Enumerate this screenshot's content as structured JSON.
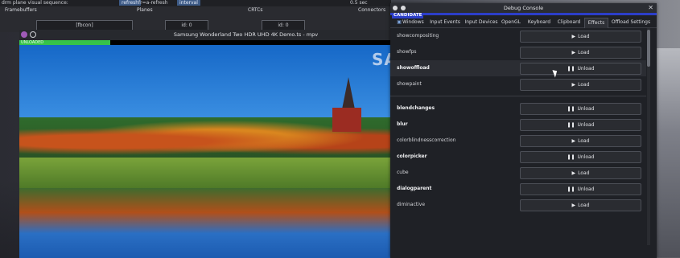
{
  "drm": {
    "topbar_left": "drm plane visual sequence:",
    "pill_1": "refresh",
    "topbar_mid": "fr=a-refresh",
    "pill_2": "interval",
    "topbar_right": "0.5 sec",
    "columns": [
      "Framebuffers",
      "Planes",
      "CRTCs",
      "Connectors"
    ],
    "fb_cell": "[fbcon]",
    "plane_cell": "id: 0",
    "crtc_cell": "id: 0"
  },
  "mpv": {
    "title": "Samsung Wonderland Two HDR UHD 4K Demo.ts - mpv",
    "progress_label": "UNLOADED",
    "progress_fraction": 0.2,
    "brand_text": "SA"
  },
  "debug": {
    "title": "Debug Console",
    "badge": "CANDIDATE",
    "tabs": [
      "Windows",
      "Input Events",
      "Input Devices",
      "OpenGL",
      "Keyboard",
      "Clipboard",
      "Effects",
      "Offload Settings"
    ],
    "active_tab": "Effects",
    "load_label": "Load",
    "unload_label": "Unload",
    "effects": [
      {
        "name": "showcompositing",
        "action": "Load",
        "bold": false
      },
      {
        "name": "showfps",
        "action": "Load",
        "bold": false
      },
      {
        "name": "showoffload",
        "action": "Unload",
        "bold": true
      },
      {
        "name": "showpaint",
        "action": "Load",
        "bold": false
      },
      {
        "name": "blendchanges",
        "action": "Unload",
        "bold": true
      },
      {
        "name": "blur",
        "action": "Unload",
        "bold": true
      },
      {
        "name": "colorblindnesscorrection",
        "action": "Load",
        "bold": false
      },
      {
        "name": "colorpicker",
        "action": "Unload",
        "bold": true
      },
      {
        "name": "cube",
        "action": "Load",
        "bold": false
      },
      {
        "name": "dialogparent",
        "action": "Unload",
        "bold": true
      },
      {
        "name": "diminactive",
        "action": "Load",
        "bold": false
      }
    ]
  },
  "colors": {
    "accent_blue": "#2c3ec9",
    "progress_green": "#36c24a"
  }
}
